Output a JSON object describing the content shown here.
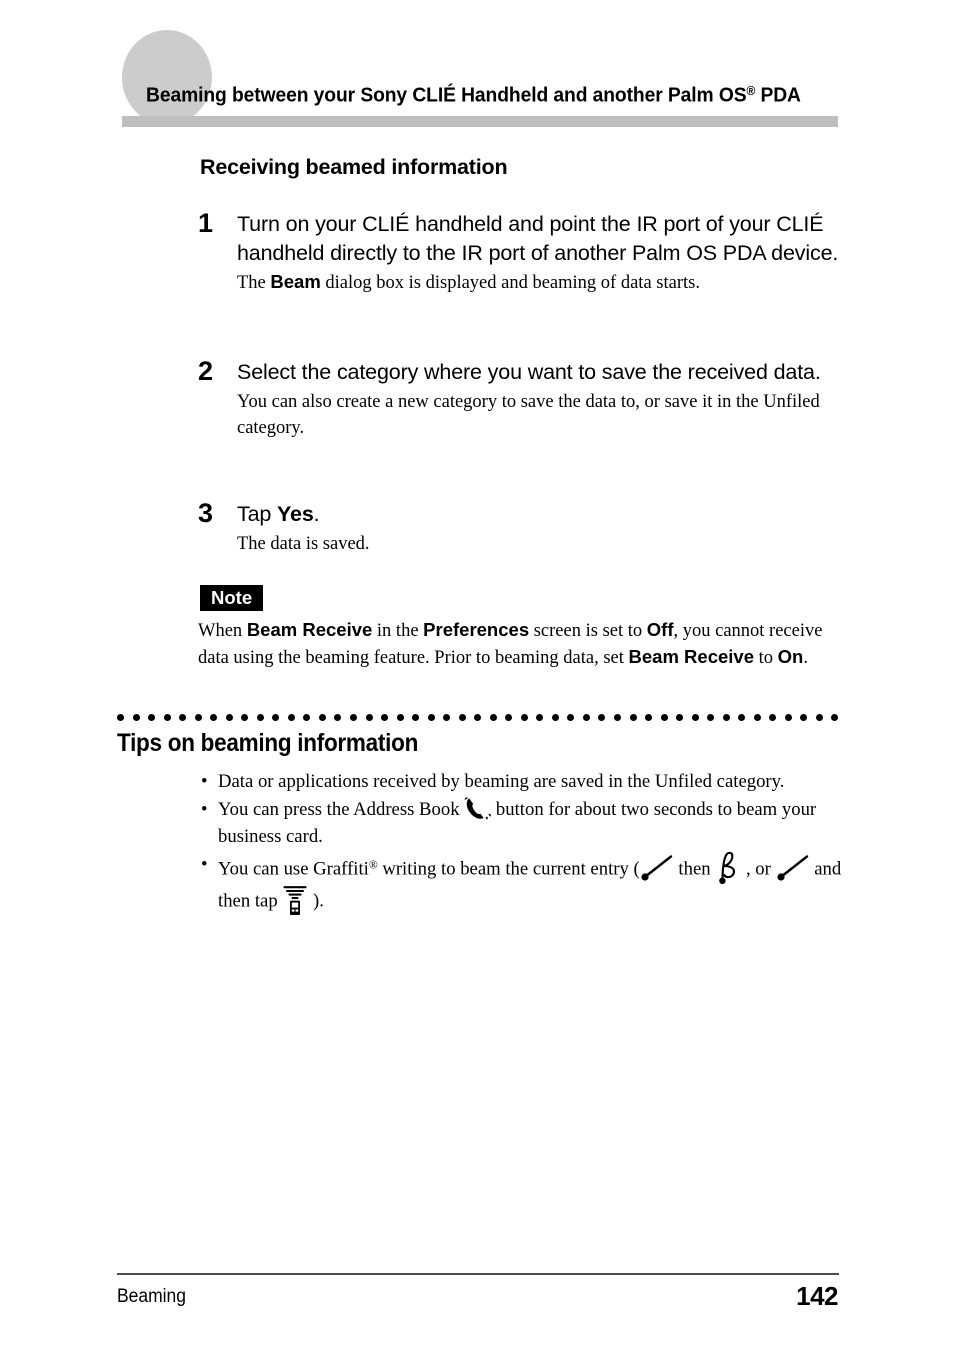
{
  "header": {
    "title_main": "Beaming between your Sony CLIÉ Handheld and another Palm OS",
    "title_sup": "®",
    "title_tail": " PDA"
  },
  "section": {
    "heading": "Receiving beamed information"
  },
  "steps": [
    {
      "number": "1",
      "main": "Turn on your CLIÉ handheld and point the IR port of your CLIÉ handheld directly to the IR port of another Palm OS PDA device.",
      "sub_pre": "The ",
      "sub_bold": "Beam",
      "sub_post": " dialog box is displayed and beaming of data starts."
    },
    {
      "number": "2",
      "main": "Select the category where you want to save the received data.",
      "sub_pre": "You can also create a new category to save the data to, or save it in the Unfiled category.",
      "sub_bold": "",
      "sub_post": ""
    },
    {
      "number": "3",
      "main_pre": "Tap ",
      "main_bold": "Yes",
      "main_post": ".",
      "sub_pre": "The data is saved.",
      "sub_bold": "",
      "sub_post": ""
    }
  ],
  "note": {
    "badge": "Note",
    "p1": "When ",
    "b1": "Beam Receive",
    "p2": " in the ",
    "b2": "Preferences",
    "p3": " screen is set to ",
    "b3": "Off",
    "p4": ", you cannot receive data using the beaming feature. Prior to beaming data, set ",
    "b4": "Beam Receive",
    "p5": " to ",
    "b5": "On",
    "p6": "."
  },
  "tips": {
    "heading": "Tips on beaming information",
    "bullet_char": "•",
    "items": [
      {
        "text": "Data or applications received by beaming are saved in the Unfiled category."
      },
      {
        "pre": "You can press the Address Book ",
        "icon": "phone-icon",
        "post": " button for about two seconds to beam your business card."
      },
      {
        "pre": "You can use Graffiti",
        "sup": "®",
        "mid1": " writing to beam the current entry (",
        "icon1": "graffiti-stroke-icon",
        "mid2": " then ",
        "icon2": "graffiti-b-stroke-icon",
        "mid3": " , or ",
        "icon3": "graffiti-stroke-icon",
        "mid4": " and then tap ",
        "icon4": "beam-device-icon",
        "post": " )."
      }
    ]
  },
  "footer": {
    "left": "Beaming",
    "page": "142"
  },
  "colors": {
    "header_circle": "#cccccc",
    "header_bar": "#bfbfbf",
    "note_badge_bg": "#000000",
    "note_badge_fg": "#ffffff",
    "footer_rule": "#4d4d4d",
    "text": "#000000"
  }
}
